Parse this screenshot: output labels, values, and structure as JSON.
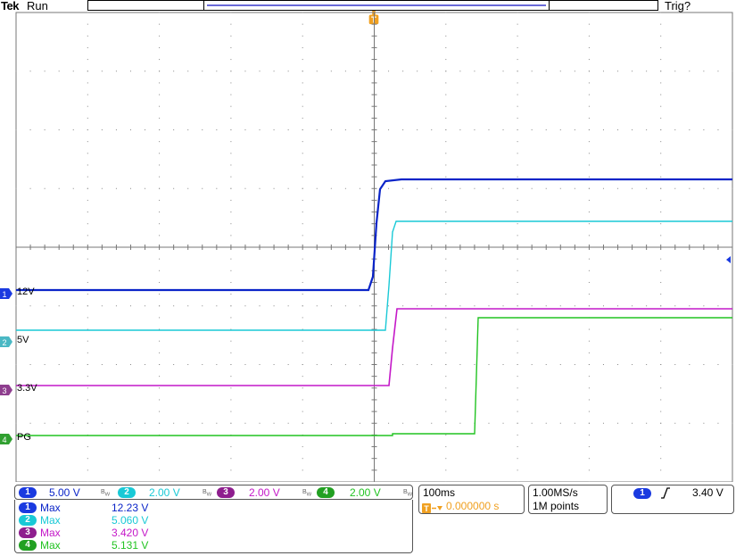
{
  "header": {
    "brand": "Tek",
    "acq_state": "Run",
    "trigger_status": "Trig?",
    "trigger_marker": "T"
  },
  "channels": [
    {
      "id": "1",
      "label": "12V",
      "scale": "5.00 V",
      "color": "#0a24c8",
      "meas_name": "Max",
      "meas_value": "12.23 V",
      "marker_color": "#1a3ae0"
    },
    {
      "id": "2",
      "label": "5V",
      "scale": "2.00 V",
      "color": "#19c9d6",
      "meas_name": "Max",
      "meas_value": "5.060 V",
      "marker_color": "#4ab8c4"
    },
    {
      "id": "3",
      "label": "3.3V",
      "scale": "2.00 V",
      "color": "#c418c8",
      "meas_name": "Max",
      "meas_value": "3.420 V",
      "marker_color": "#8e3e8e"
    },
    {
      "id": "4",
      "label": "PG",
      "scale": "2.00 V",
      "color": "#21c321",
      "meas_name": "Max",
      "meas_value": "5.131 V",
      "marker_color": "#30a030"
    }
  ],
  "bandwidth_icon": "bw-limit-icon",
  "timebase": {
    "scale": "100ms",
    "position": "0.000000 s",
    "position_icon": "trigger-delay-icon"
  },
  "acquisition": {
    "rate": "1.00MS/s",
    "record": "1M points"
  },
  "trigger": {
    "source": "1",
    "slope_icon": "rising-edge-icon",
    "level": "3.40 V"
  },
  "colors": {
    "accent_orange": "#f0a020",
    "grid": "#888888"
  }
}
